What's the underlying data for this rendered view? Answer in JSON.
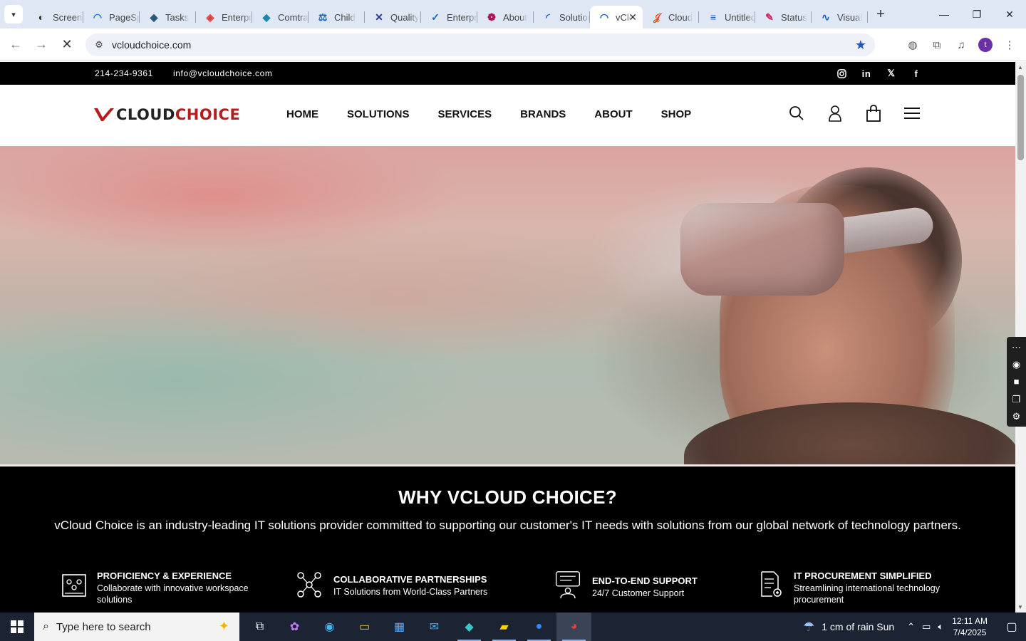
{
  "browser": {
    "tabs": [
      {
        "title": "Screencast",
        "fav_color": "#2a2a2a",
        "fav_glyph": "◐"
      },
      {
        "title": "PageSpeed",
        "fav_color": "#1a73e8",
        "fav_glyph": "◠"
      },
      {
        "title": "Tasks",
        "fav_color": "#2b5876",
        "fav_glyph": "◆"
      },
      {
        "title": "Enterprise",
        "fav_color": "#e53935",
        "fav_glyph": "◈"
      },
      {
        "title": "Comtrade",
        "fav_color": "#1e88a8",
        "fav_glyph": "◆"
      },
      {
        "title": "Child",
        "fav_color": "#1565c0",
        "fav_glyph": "⚖"
      },
      {
        "title": "Quality",
        "fav_color": "#283593",
        "fav_glyph": "✕"
      },
      {
        "title": "Enterprise",
        "fav_color": "#1565c0",
        "fav_glyph": "✓"
      },
      {
        "title": "About",
        "fav_color": "#ad1457",
        "fav_glyph": "❁"
      },
      {
        "title": "Solutions",
        "fav_color": "#1565c0",
        "fav_glyph": "◜"
      },
      {
        "title": "vCloud Choice",
        "fav_color": "#1565c0",
        "fav_glyph": "◠",
        "active": true
      },
      {
        "title": "Cloud",
        "fav_color": "#e64a19",
        "fav_glyph": "𝒥"
      },
      {
        "title": "Untitled",
        "fav_color": "#1e63c8",
        "fav_glyph": "≡"
      },
      {
        "title": "Status",
        "fav_color": "#d81b60",
        "fav_glyph": "✎"
      },
      {
        "title": "Visual",
        "fav_color": "#1565c0",
        "fav_glyph": "∿"
      }
    ],
    "url": "vcloudchoice.com",
    "profile_initial": "t",
    "new_tab_label": "+",
    "active_tab_close": "✕"
  },
  "topbar": {
    "phone": "214-234-9361",
    "email": "info@vcloudchoice.com",
    "social": [
      "instagram",
      "linkedin",
      "x",
      "facebook"
    ]
  },
  "header": {
    "logo_v": "V",
    "logo_cloud": "CLOUD",
    "logo_choice": "CHOICE",
    "nav": [
      "HOME",
      "SOLUTIONS",
      "SERVICES",
      "BRANDS",
      "ABOUT",
      "SHOP"
    ]
  },
  "why": {
    "title": "WHY VCLOUD CHOICE?",
    "tagline": "vCloud Choice is an industry-leading IT solutions provider committed to supporting our customer's IT needs with solutions from our global network of technology partners.",
    "features": [
      {
        "title": "PROFICIENCY & EXPERIENCE",
        "desc": "Collaborate with innovative workspace solutions"
      },
      {
        "title": "COLLABORATIVE PARTNERSHIPS",
        "desc": "IT Solutions from World-Class Partners"
      },
      {
        "title": "END-TO-END SUPPORT",
        "desc": "24/7 Customer Support"
      },
      {
        "title": "IT PROCUREMENT SIMPLIFIED",
        "desc": "Streamlining international technology procurement"
      }
    ]
  },
  "taskbar": {
    "search_placeholder": "Type here to search",
    "weather": "1 cm of rain Sun",
    "time": "12:11 AM",
    "date": "7/4/2025"
  },
  "colors": {
    "brand_red": "#b71c1c",
    "topbar_bg": "#000000",
    "accent_blue": "#1a56d6"
  }
}
